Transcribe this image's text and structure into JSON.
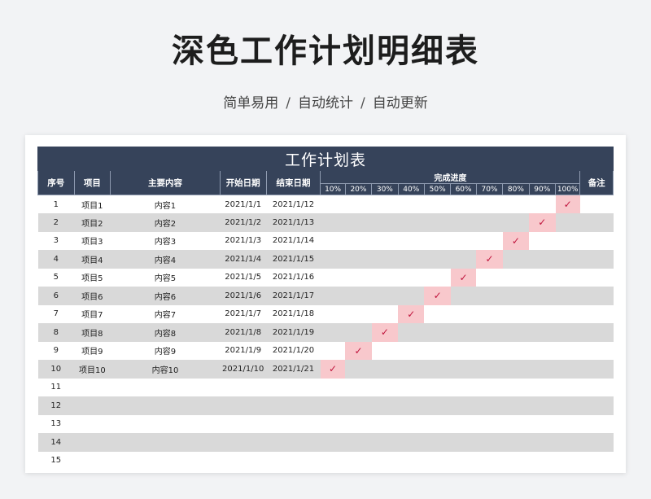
{
  "page": {
    "title": "深色工作计划明细表",
    "subtitle": [
      "简单易用",
      "自动统计",
      "自动更新"
    ],
    "separator": "/"
  },
  "sheet": {
    "table_title": "工作计划表",
    "headers": {
      "seq": "序号",
      "project": "项目",
      "content": "主要内容",
      "start": "开始日期",
      "end": "结束日期",
      "progress": "完成进度",
      "note": "备注"
    },
    "progress_levels": [
      "10%",
      "20%",
      "30%",
      "40%",
      "50%",
      "60%",
      "70%",
      "80%",
      "90%",
      "100%"
    ],
    "check_mark": "✓",
    "rows": [
      {
        "seq": "1",
        "project": "项目1",
        "content": "内容1",
        "start": "2021/1/1",
        "end": "2021/1/12",
        "progress": 10
      },
      {
        "seq": "2",
        "project": "项目2",
        "content": "内容2",
        "start": "2021/1/2",
        "end": "2021/1/13",
        "progress": 9
      },
      {
        "seq": "3",
        "project": "项目3",
        "content": "内容3",
        "start": "2021/1/3",
        "end": "2021/1/14",
        "progress": 8
      },
      {
        "seq": "4",
        "project": "项目4",
        "content": "内容4",
        "start": "2021/1/4",
        "end": "2021/1/15",
        "progress": 7
      },
      {
        "seq": "5",
        "project": "项目5",
        "content": "内容5",
        "start": "2021/1/5",
        "end": "2021/1/16",
        "progress": 6
      },
      {
        "seq": "6",
        "project": "项目6",
        "content": "内容6",
        "start": "2021/1/6",
        "end": "2021/1/17",
        "progress": 5
      },
      {
        "seq": "7",
        "project": "项目7",
        "content": "内容7",
        "start": "2021/1/7",
        "end": "2021/1/18",
        "progress": 4
      },
      {
        "seq": "8",
        "project": "项目8",
        "content": "内容8",
        "start": "2021/1/8",
        "end": "2021/1/19",
        "progress": 3
      },
      {
        "seq": "9",
        "project": "项目9",
        "content": "内容9",
        "start": "2021/1/9",
        "end": "2021/1/20",
        "progress": 2
      },
      {
        "seq": "10",
        "project": "项目10",
        "content": "内容10",
        "start": "2021/1/10",
        "end": "2021/1/21",
        "progress": 1
      },
      {
        "seq": "11"
      },
      {
        "seq": "12"
      },
      {
        "seq": "13"
      },
      {
        "seq": "14"
      },
      {
        "seq": "15"
      }
    ]
  }
}
